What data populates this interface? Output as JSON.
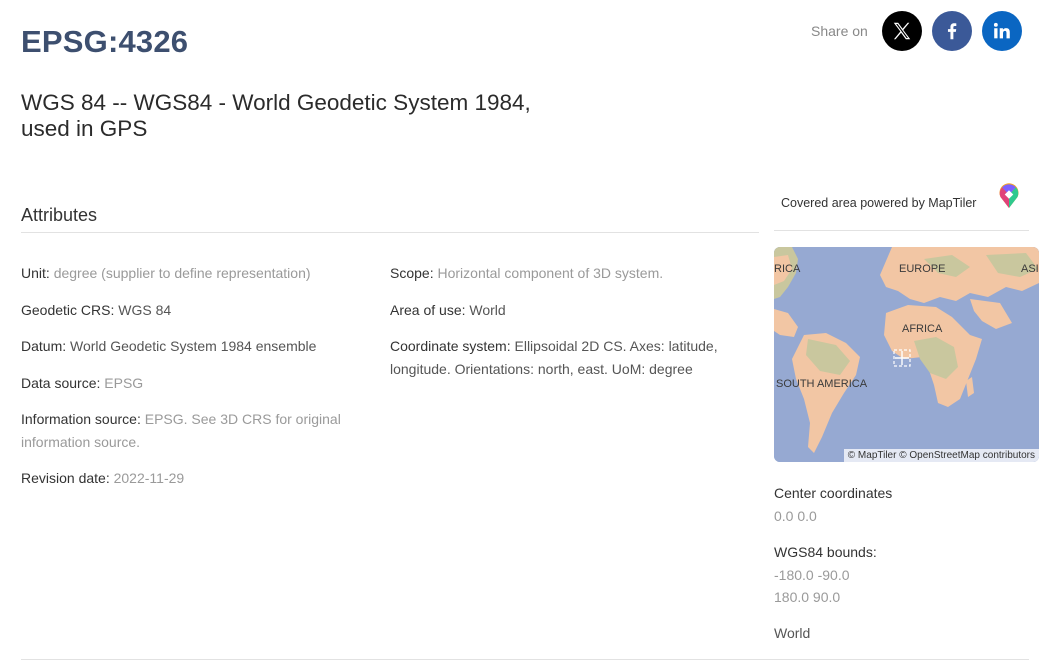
{
  "header": {
    "code": "EPSG:4326",
    "name": "WGS 84 -- WGS84 - World Geodetic System 1984, used in GPS"
  },
  "share": {
    "label": "Share on",
    "buttons": [
      {
        "name": "x",
        "icon": "x-logo-icon",
        "color": "#000000"
      },
      {
        "name": "facebook",
        "icon": "facebook-icon",
        "color": "#3b5998"
      },
      {
        "name": "linkedin",
        "icon": "linkedin-icon",
        "color": "#0a66c2"
      }
    ]
  },
  "attributes": {
    "heading": "Attributes",
    "unit": {
      "label": "Unit:",
      "value": "degree (supplier to define representation)"
    },
    "geodetic_crs": {
      "label": "Geodetic CRS:",
      "value": "WGS 84"
    },
    "datum": {
      "label": "Datum:",
      "value": "World Geodetic System 1984 ensemble"
    },
    "data_source": {
      "label": "Data source:",
      "value": "EPSG"
    },
    "information_source": {
      "label": "Information source:",
      "value": "EPSG. See 3D CRS for original information source."
    },
    "revision_date": {
      "label": "Revision date:",
      "value": "2022-11-29"
    },
    "scope": {
      "label": "Scope:",
      "value": "Horizontal component of 3D system."
    },
    "area_of_use": {
      "label": "Area of use:",
      "value": "World"
    },
    "coordinate_system": {
      "label": "Coordinate system:",
      "value": "Ellipsoidal 2D CS. Axes: latitude, longitude. Orientations: north, east. UoM: degree"
    }
  },
  "map": {
    "powered_text": "Covered area powered by MapTiler",
    "labels": [
      "RICA",
      "EUROPE",
      "ASI",
      "AFRICA",
      "SOUTH AMERICA"
    ],
    "attribution": "© MapTiler © OpenStreetMap contributors",
    "colors": {
      "ocean": "#96a9d2",
      "land_a": "#f2c6a4",
      "land_b": "#c9c79e"
    }
  },
  "side": {
    "center_label": "Center coordinates",
    "center_value": "0.0 0.0",
    "bounds_label": "WGS84 bounds:",
    "bounds_min": "-180.0 -90.0",
    "bounds_max": "180.0 90.0",
    "area": "World"
  }
}
